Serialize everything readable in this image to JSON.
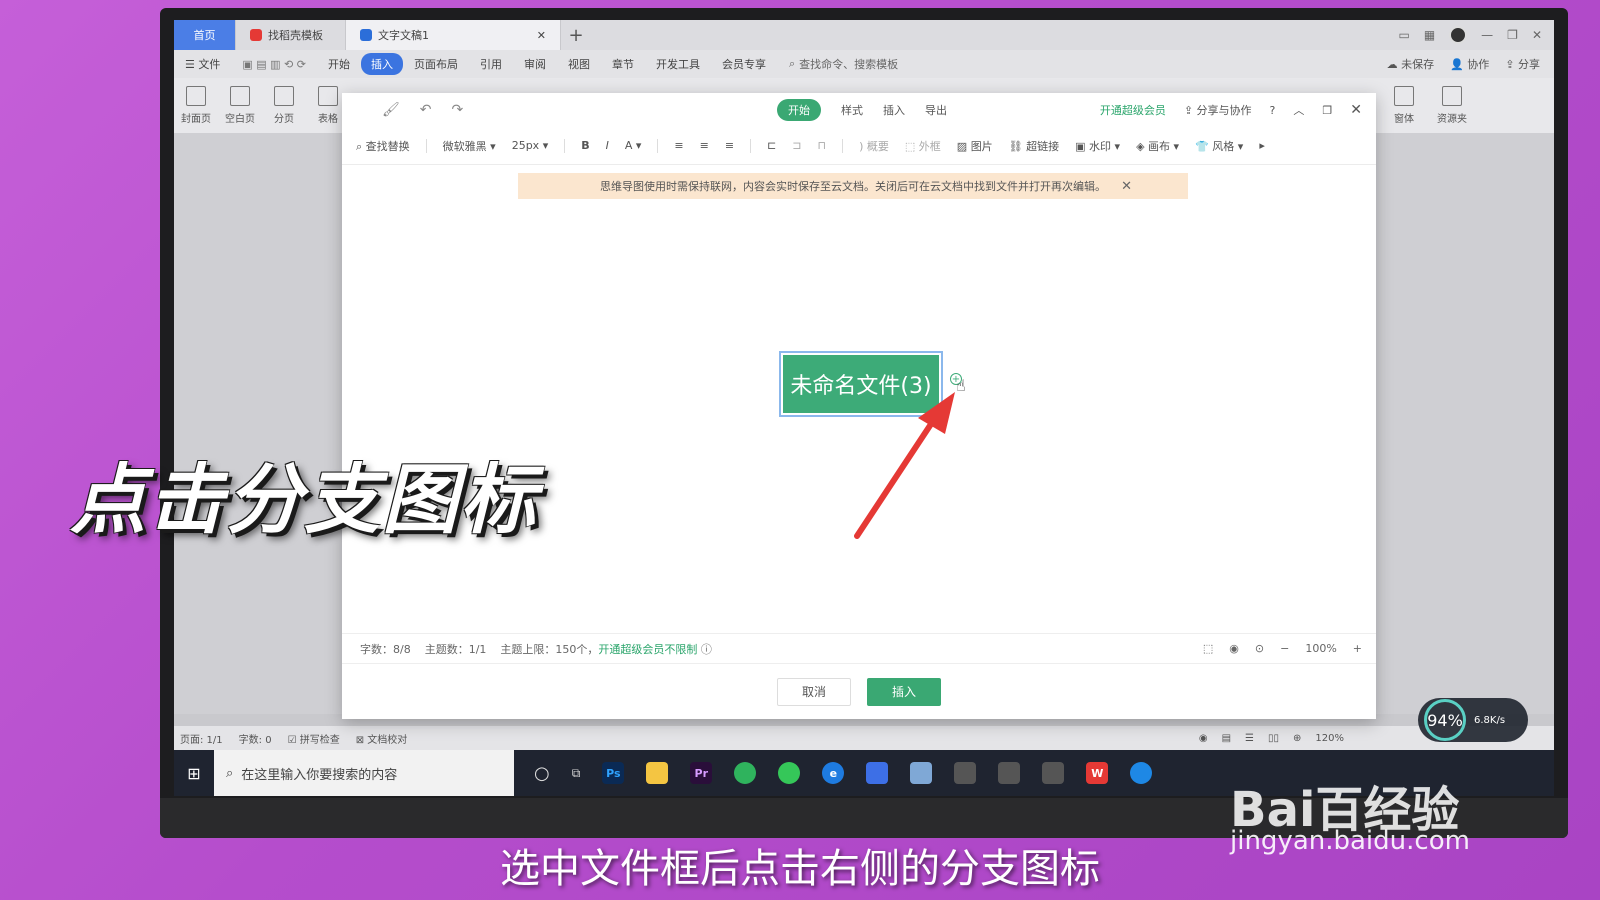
{
  "tabs": {
    "home": "首页",
    "template": "找稻壳模板",
    "document": "文字文稿1"
  },
  "menu": {
    "file": "文件",
    "items": [
      "开始",
      "插入",
      "页面布局",
      "引用",
      "审阅",
      "视图",
      "章节",
      "开发工具",
      "会员专享"
    ],
    "active_index": 1,
    "search": "查找命令、搜索模板",
    "unsaved": "未保存",
    "collab": "协作",
    "share": "分享"
  },
  "ribbon": {
    "cover": "封面页",
    "blank": "空白页",
    "pagebreak": "分页",
    "table": "表格",
    "window": "窗体",
    "resource": "资源夹"
  },
  "dialog": {
    "tabs": [
      "开始",
      "样式",
      "插入",
      "导出"
    ],
    "active_tab": 0,
    "vip": "开通超级会员",
    "share_collab": "分享与协作",
    "toolbar": {
      "find_replace": "查找替换",
      "font": "微软雅黑",
      "size": "25px",
      "summary": "概要",
      "outline": "外框",
      "image": "图片",
      "hyperlink": "超链接",
      "watermark": "水印",
      "canvas": "画布",
      "style": "风格"
    },
    "notice": "思维导图使用时需保持联网，内容会实时保存至云文档。关闭后可在云文档中找到文件并打开再次编辑。",
    "node_text": "未命名文件(3)",
    "info": {
      "chars": "字数：8/8",
      "topics": "主题数：1/1",
      "limit": "主题上限：150个，",
      "limit_link": "开通超级会员不限制",
      "zoom": "100%"
    },
    "cancel": "取消",
    "insert": "插入"
  },
  "statusbar": {
    "page": "页面: 1/1",
    "words": "字数: 0",
    "spell": "拼写检查",
    "proof": "文档校对",
    "zoom": "120%"
  },
  "taskbar": {
    "search_placeholder": "在这里输入你要搜索的内容"
  },
  "overlay": {
    "caption": "点击分支图标",
    "subtitle": "选中文件框后点击右侧的分支图标",
    "speed_pct": "94%",
    "speed_up": "6.8K/s",
    "watermark": "Bai百经验",
    "watermark_url": "jingyan.baidu.com"
  },
  "colors": {
    "accent_green": "#3aa873",
    "tab_blue": "#4b7ee6",
    "arrow_red": "#e53935"
  }
}
